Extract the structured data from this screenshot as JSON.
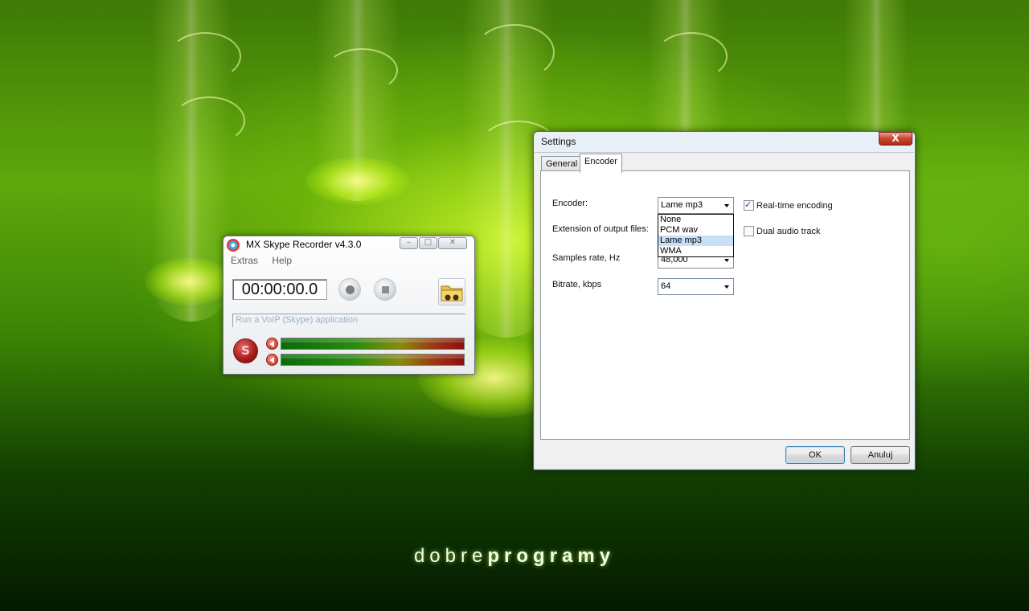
{
  "branding": {
    "part1": "dobre",
    "part2": "programy"
  },
  "recorder": {
    "title": "MX Skype Recorder v4.3.0",
    "menu": [
      "Extras",
      "Help"
    ],
    "timer": "00:00:00.0",
    "status": "Run a VoIP (Skype) application",
    "skype_letter": "S"
  },
  "settings": {
    "title": "Settings",
    "close_label": "X",
    "tabs": [
      "General",
      "Encoder"
    ],
    "active_tab": "Encoder",
    "labels": {
      "encoder": "Encoder:",
      "extension": "Extension of output files:",
      "samples": "Samples rate, Hz",
      "bitrate": "Bitrate, kbps"
    },
    "encoder_value": "Lame mp3",
    "encoder_options": [
      "None",
      "PCM wav",
      "Lame mp3",
      "WMA"
    ],
    "encoder_selected_index": 2,
    "samples_value": "48,000",
    "bitrate_value": "64",
    "realtime_label": "Real-time encoding",
    "realtime_checked": true,
    "dual_label": "Dual audio track",
    "dual_checked": false,
    "ok_label": "OK",
    "cancel_label": "Anuluj"
  }
}
